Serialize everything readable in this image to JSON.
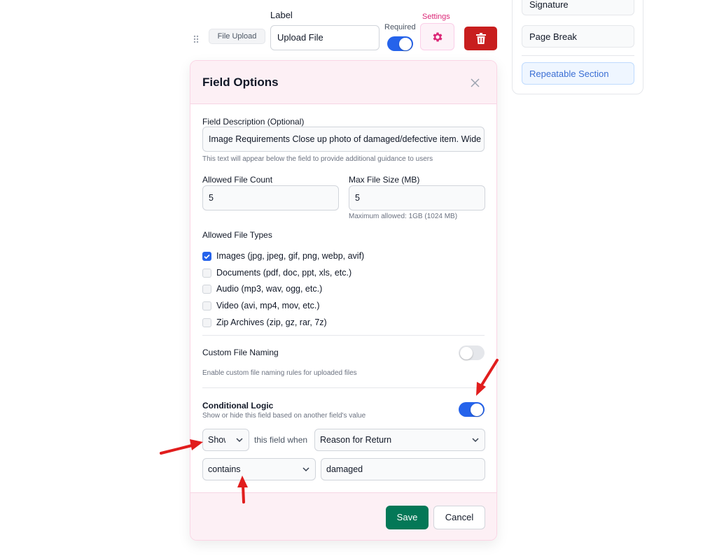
{
  "side_panel": {
    "items": [
      {
        "label": "Signature"
      },
      {
        "label": "Page Break"
      },
      {
        "label": "Repeatable Section"
      }
    ]
  },
  "field_row": {
    "type_badge": "File Upload",
    "label_caption": "Label",
    "label_value": "Upload File",
    "required_caption": "Required",
    "required_on": true,
    "settings_caption": "Settings"
  },
  "modal": {
    "title": "Field Options",
    "description": {
      "label": "Field Description (Optional)",
      "value": "Image Requirements       Close up photo of damaged/defective item. Wide angle",
      "hint": "This text will appear below the field to provide additional guidance to users"
    },
    "file_count": {
      "label": "Allowed File Count",
      "value": "5"
    },
    "max_size": {
      "label": "Max File Size (MB)",
      "value": "5",
      "hint": "Maximum allowed: 1GB (1024 MB)"
    },
    "file_types": {
      "label": "Allowed File Types",
      "options": [
        {
          "label": "Images (jpg, jpeg, gif, png, webp, avif)",
          "checked": true
        },
        {
          "label": "Documents (pdf, doc, ppt, xls, etc.)",
          "checked": false
        },
        {
          "label": "Audio (mp3, wav, ogg, etc.)",
          "checked": false
        },
        {
          "label": "Video (avi, mp4, mov, etc.)",
          "checked": false
        },
        {
          "label": "Zip Archives (zip, gz, rar, 7z)",
          "checked": false
        }
      ]
    },
    "custom_naming": {
      "label": "Custom File Naming",
      "hint": "Enable custom file naming rules for uploaded files",
      "on": false
    },
    "conditional": {
      "label": "Conditional Logic",
      "hint": "Show or hide this field based on another field's value",
      "on": true,
      "action": "Show",
      "connector": "this field when",
      "field": "Reason for Return",
      "operator": "contains",
      "value": "damaged"
    },
    "save_label": "Save",
    "cancel_label": "Cancel"
  },
  "colors": {
    "accent_blue": "#2563eb",
    "pink": "#db2777",
    "danger": "#c81e1e",
    "save_green": "#047857",
    "annotation_arrow": "#e11d1d"
  }
}
